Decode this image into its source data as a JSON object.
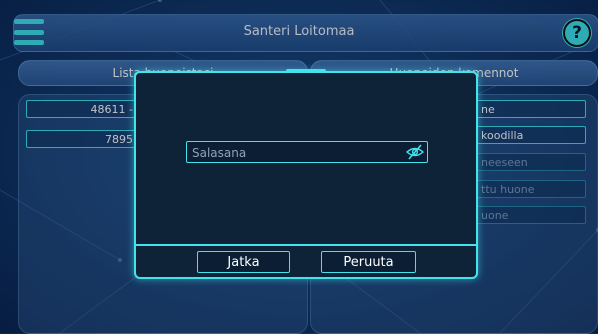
{
  "header": {
    "title": "Santeri Loitomaa",
    "menu_icon": "hamburger-menu-icon",
    "help_icon": "question-mark-icon"
  },
  "tabs": {
    "left": "Lista huoneistasi",
    "right": "Huoneiden komennot"
  },
  "rooms": [
    {
      "label": "48611 -"
    },
    {
      "label": "7895"
    }
  ],
  "commands": [
    {
      "label": "ne"
    },
    {
      "label": "koodilla"
    },
    {
      "label": "neeseen"
    },
    {
      "label": "ttu huone"
    },
    {
      "label": "uone"
    }
  ],
  "dialog": {
    "password_placeholder": "Salasana",
    "password_value": "",
    "toggle_icon": "eye-slash-icon",
    "continue_label": "Jatka",
    "cancel_label": "Peruuta"
  },
  "colors": {
    "accent": "#43e3ec",
    "modal_bg": "#0e2238",
    "background": "#123a6e"
  }
}
